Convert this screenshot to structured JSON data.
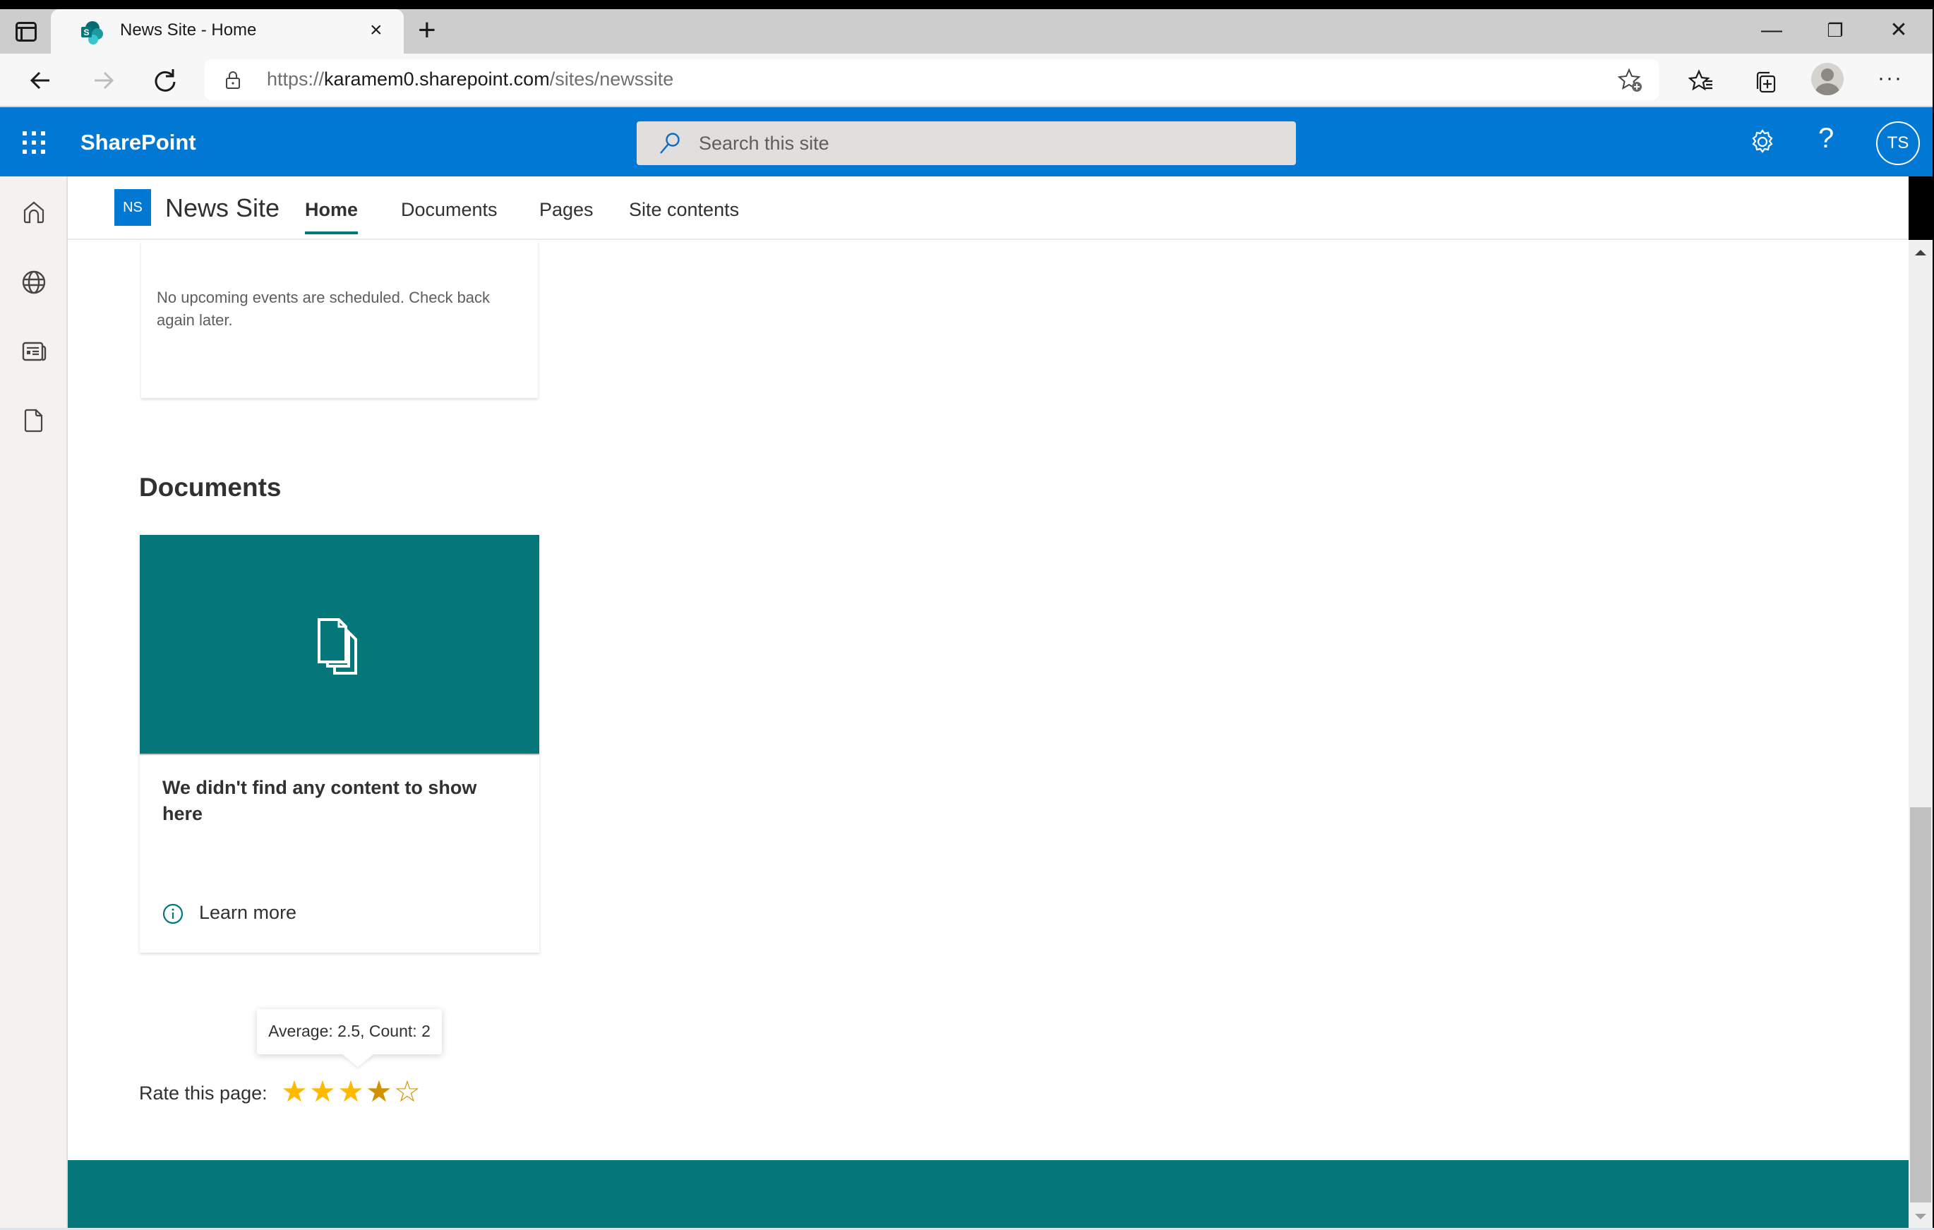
{
  "browser": {
    "tab_title": "News Site - Home",
    "tab_close": "×",
    "new_tab": "+",
    "url_prefix": "https://",
    "url_host": "karamem0.sharepoint.com",
    "url_path": "/sites/newssite",
    "window_controls": {
      "minimize": "—",
      "restore": "❐",
      "close": "✕"
    },
    "more_label": "···",
    "icons": [
      "tab-actions-icon",
      "back-icon",
      "forward-icon",
      "refresh-icon",
      "lock-icon",
      "add-favorite-icon",
      "favorites-icon",
      "collections-icon",
      "profile-icon",
      "more-icon"
    ]
  },
  "suitebar": {
    "brand": "SharePoint",
    "search_placeholder": "Search this site",
    "help": "?",
    "user_initials": "TS",
    "color": "#0078d4"
  },
  "rail": {
    "items": [
      {
        "icon": "home-icon",
        "label": "Home"
      },
      {
        "icon": "globe-icon",
        "label": "Sites"
      },
      {
        "icon": "news-icon",
        "label": "News"
      },
      {
        "icon": "file-icon",
        "label": "Files"
      }
    ]
  },
  "site": {
    "logo_initials": "NS",
    "name": "News Site",
    "nav": [
      {
        "label": "Home",
        "active": true
      },
      {
        "label": "Documents",
        "active": false
      },
      {
        "label": "Pages",
        "active": false
      },
      {
        "label": "Site contents",
        "active": false
      }
    ],
    "accent_color": "#03787c"
  },
  "events": {
    "empty_message": "No upcoming events are scheduled. Check back again later."
  },
  "documents": {
    "heading": "Documents",
    "empty_message": "We didn't find any content to show here",
    "learn_more": "Learn more",
    "hero_color": "#05777b"
  },
  "rating": {
    "label": "Rate this page:",
    "tooltip": "Average: 2.5, Count: 2",
    "max_stars": 5,
    "highlighted_stars": 4,
    "average": 2.5,
    "count": 2,
    "star_filled": "★",
    "star_empty": "☆"
  }
}
